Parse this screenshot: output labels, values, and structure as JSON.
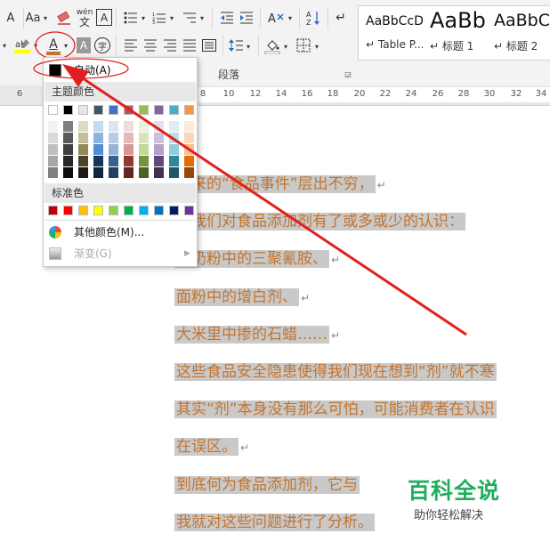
{
  "ribbon": {
    "row1": {
      "font_size_grow": "A",
      "change_case": "Aa",
      "phonetic_guide": "wén",
      "border_char": "A"
    },
    "row2": {
      "font_color": "A",
      "char_shading": "A",
      "enclose_char": "字"
    },
    "styles": [
      {
        "sample": "AaBbCcD",
        "name": "↵ Table P..."
      },
      {
        "sample": "AaBb",
        "name": "↵ 标题 1"
      },
      {
        "sample": "AaBbC",
        "name": "↵ 标题 2"
      }
    ],
    "paragraph_group_label": "段落"
  },
  "ruler": {
    "left_label": "6",
    "ticks": [
      "8",
      "10",
      "12",
      "14",
      "16",
      "18",
      "20",
      "22",
      "24",
      "26",
      "28",
      "30",
      "32",
      "34"
    ]
  },
  "color_menu": {
    "automatic_label": "自动(A)",
    "theme_header": "主题颜色",
    "theme_colors_top": [
      "#ffffff",
      "#000000",
      "#e7e6e6",
      "#44546a",
      "#4472c4",
      "#ed7d31",
      "#a5a5a5",
      "#ffc000",
      "#5b9bd5",
      "#70ad47"
    ],
    "theme_colors_top_menu": [
      "#ffffff",
      "#000000",
      "#e7e6e6",
      "#44546a",
      "#4472c4",
      "#c0504d",
      "#9bbb59",
      "#8064a2",
      "#4bacc6",
      "#f79646"
    ],
    "theme_shade_columns": [
      [
        "#f2f2f2",
        "#d9d9d9",
        "#bfbfbf",
        "#a6a6a6",
        "#7f7f7f"
      ],
      [
        "#7f7f7f",
        "#595959",
        "#3f3f3f",
        "#262626",
        "#0d0d0d"
      ],
      [
        "#ddd9c3",
        "#c4bd97",
        "#938953",
        "#494429",
        "#1d1b10"
      ],
      [
        "#c6d9f0",
        "#8db3e2",
        "#548dd4",
        "#17365d",
        "#0f243e"
      ],
      [
        "#dbe5f1",
        "#b8cce4",
        "#95b3d7",
        "#366092",
        "#244061"
      ],
      [
        "#f2dcdb",
        "#e5b9b7",
        "#d99694",
        "#953734",
        "#632423"
      ],
      [
        "#ebf1dd",
        "#d7e3bc",
        "#c3d69b",
        "#76923c",
        "#4f6128"
      ],
      [
        "#e5e0ec",
        "#ccc1d9",
        "#b2a2c7",
        "#5f497a",
        "#3f3151"
      ],
      [
        "#dbeef3",
        "#b7dde8",
        "#92cddc",
        "#31859b",
        "#205867"
      ],
      [
        "#fdeada",
        "#fbd5b5",
        "#fac08f",
        "#e36c09",
        "#974806"
      ]
    ],
    "standard_header": "标准色",
    "standard_colors": [
      "#c00000",
      "#ff0000",
      "#ffc000",
      "#ffff00",
      "#92d050",
      "#00b050",
      "#00b0f0",
      "#0070c0",
      "#002060",
      "#7030a0"
    ],
    "more_colors_label": "其他颜色(M)...",
    "gradient_label": "渐变(G)"
  },
  "document": {
    "lines": [
      {
        "text": "",
        "mark": "↵"
      },
      {
        "text": "年来的“食品事件”层出不穷，",
        "mark": "↵"
      },
      {
        "text": "得我们对食品添加剂有了或多或少的认识：",
        "mark": ""
      },
      {
        "text": "鹿奶粉中的三聚氰胺、",
        "mark": "↵"
      },
      {
        "text": "面粉中的增白剂、",
        "mark": "↵"
      },
      {
        "text": "大米里中掺的石蜡……",
        "mark": "↵"
      },
      {
        "text": "这些食品安全隐患使得我们现在想到“剂”就不寒",
        "mark": ""
      },
      {
        "text": "其实“剂”本身没有那么可怕，可能消费者在认识",
        "mark": ""
      },
      {
        "text": "在误区。",
        "mark": "↵"
      },
      {
        "text": "到底何为食品添加剂，它与",
        "mark": ""
      },
      {
        "text": "我就对这些问题进行了分析。",
        "mark": ""
      }
    ],
    "text_color": "#c4742e",
    "highlight_color": "#c9c9c9"
  },
  "watermark": {
    "title": "百科全说",
    "subtitle": "助你轻松解决"
  },
  "annotation_color": "#e02020"
}
